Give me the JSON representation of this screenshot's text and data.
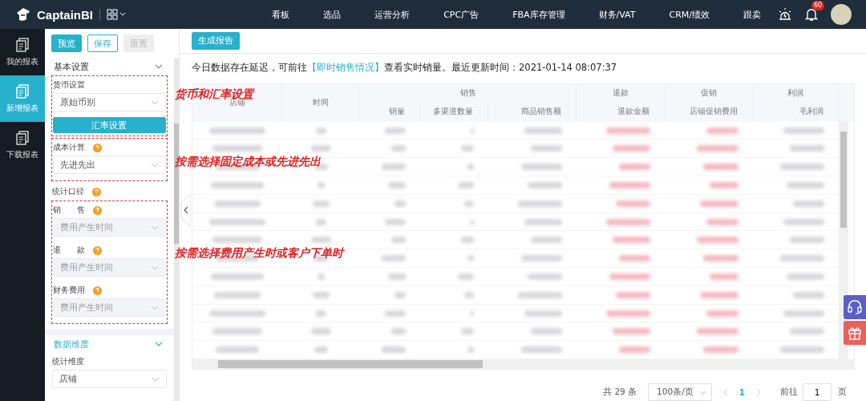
{
  "topbar": {
    "logo": "CaptainBI",
    "menu": [
      {
        "label": "看板"
      },
      {
        "label": "选品"
      },
      {
        "label": "运营分析"
      },
      {
        "label": "CPC广告"
      },
      {
        "label": "FBA库存管理"
      },
      {
        "label": "财务/VAT"
      },
      {
        "label": "CRM/绩效"
      },
      {
        "label": "跟卖"
      }
    ],
    "notification_count": "60"
  },
  "side_nav": [
    {
      "label": "我的报表",
      "selected": false
    },
    {
      "label": "新增报表",
      "selected": true
    },
    {
      "label": "下载报表",
      "selected": false
    }
  ],
  "toolbar": [
    {
      "label": "预览",
      "kind": "primary"
    },
    {
      "label": "保存",
      "kind": "outline"
    },
    {
      "label": "重置",
      "kind": "disabled"
    }
  ],
  "settings": [
    {
      "title": "基本设置",
      "active": false,
      "groups": [
        {
          "framed": true,
          "note": "货币和汇率设置",
          "rows": [
            {
              "kind": "label",
              "text": "货币设置"
            },
            {
              "kind": "select",
              "value": "原始币别",
              "disabled": false
            },
            {
              "kind": "button",
              "label": "汇率设置"
            }
          ]
        },
        {
          "framed": true,
          "note": "按需选择固定成本或先进先出",
          "rows": [
            {
              "kind": "label",
              "text": "成本计算",
              "help": true
            },
            {
              "kind": "select",
              "value": "先进先出",
              "disabled": false
            }
          ]
        },
        {
          "framed": false,
          "rows": [
            {
              "kind": "label",
              "text": "统计口径",
              "help": true
            }
          ]
        },
        {
          "framed": true,
          "note": "按需选择费用产生时或客户下单时",
          "rows": [
            {
              "kind": "label",
              "text": "销　　售",
              "help": true
            },
            {
              "kind": "select",
              "placeholder": "费用产生时间",
              "disabled": true
            },
            {
              "kind": "label",
              "text": "退　　款",
              "help": true
            },
            {
              "kind": "select",
              "placeholder": "费用产生时间",
              "disabled": true
            },
            {
              "kind": "label",
              "text": "财务费用",
              "help": true
            },
            {
              "kind": "select",
              "placeholder": "费用产生时间",
              "disabled": true
            }
          ]
        }
      ]
    },
    {
      "title": "数据维度",
      "active": true,
      "groups": [
        {
          "framed": false,
          "rows": [
            {
              "kind": "label",
              "text": "统计维度"
            },
            {
              "kind": "select",
              "value": "店铺",
              "disabled": false
            }
          ]
        }
      ]
    }
  ],
  "main": {
    "generate_button": "生成报告",
    "notice": {
      "before": "今日数据存在延迟，可前往",
      "link": "【即时销售情况】",
      "after": "查看实时销量。最近更新时间：2021-01-14 08:07:37"
    },
    "table": {
      "columns": [
        {
          "label": "店铺"
        },
        {
          "label": "时间"
        },
        {
          "group": "销售",
          "children": [
            {
              "label": "销量"
            },
            {
              "label": "多渠道数量"
            },
            {
              "label": "商品销售额"
            }
          ]
        },
        {
          "group": "退款",
          "children": [
            {
              "label": "退款金额"
            }
          ]
        },
        {
          "group": "促销",
          "children": [
            {
              "label": "店铺促销费用"
            }
          ]
        },
        {
          "group": "利润",
          "children": [
            {
              "label": "毛利润"
            }
          ]
        }
      ]
    },
    "pagination": {
      "total": "共 29 条",
      "page_size": "100条/页",
      "pages": [
        {
          "label": "1",
          "selected": true
        }
      ],
      "goto_label": "前往",
      "goto_value": "1",
      "goto_suffix": "页"
    }
  }
}
